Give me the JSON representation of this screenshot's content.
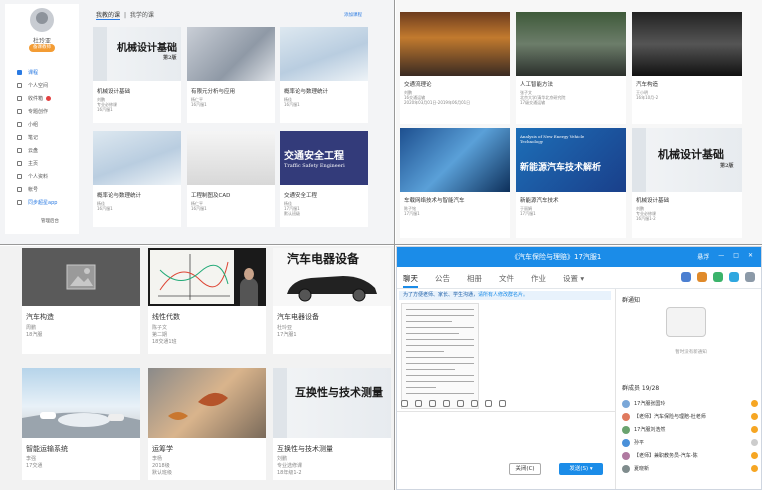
{
  "q1": {
    "user": "杜玲亚",
    "badge": "备课教师",
    "tabs": [
      "我教的课",
      "|",
      "我学的课"
    ],
    "add": "添加课程",
    "menu": [
      "课程",
      "个人空间",
      "收件箱",
      "专题创作",
      "小组",
      "笔记",
      "云盘",
      "主页",
      "个人资料",
      "帐号",
      "同步超星app"
    ],
    "manage": "管理后台",
    "cards": [
      {
        "title": "机械设计基础",
        "meta": [
          "刘鹏",
          "专业必修课",
          "16汽服1"
        ],
        "cover": "机械设计基础",
        "sub": "第2版"
      },
      {
        "title": "有限元分析与应用",
        "meta": [
          "杨仁平",
          "16汽服1"
        ]
      },
      {
        "title": "概率论与数理统计",
        "meta": [
          "杨佳",
          "16汽服1"
        ]
      },
      {
        "title": "概率论与数理统计",
        "meta": [
          "杨佳",
          "16汽服1"
        ]
      },
      {
        "title": "工程制图及CAD",
        "meta": [
          "杨仁平",
          "16汽服1"
        ]
      },
      {
        "title": "交通安全工程",
        "meta": [
          "杨佳",
          "17汽服1",
          "默认班级"
        ],
        "cover": "交通安全工程",
        "sub": "Traffic Safety Engineeri"
      }
    ]
  },
  "q2": {
    "cards": [
      {
        "title": "交通流理论",
        "meta": [
          "刘鹏",
          "16交通运输",
          "2020年03月01日-2019年06月01日"
        ]
      },
      {
        "title": "人工智能方法",
        "meta": [
          "张子文",
          "北京大学/清华北京研究院",
          "17级交通运输"
        ]
      },
      {
        "title": "汽车构造",
        "meta": [
          "王小明",
          "16年10月-2"
        ]
      },
      {
        "title": "车载网络技术与智能汽车",
        "meta": [
          "陈子铭",
          "17汽服1"
        ]
      },
      {
        "title": "新能源汽车技术",
        "meta": [
          "于丽娟",
          "17汽服1"
        ],
        "cover": "新能源汽车技术解析",
        "sub": "Analysis of New Energy Vehicle Technology"
      },
      {
        "title": "机械设计基础",
        "meta": [
          "刘鹏",
          "专业必修课",
          "16汽服1-2"
        ],
        "cover": "机械设计基础",
        "sub": "第2版"
      }
    ]
  },
  "q3": {
    "cards": [
      {
        "title": "汽车构造",
        "meta": [
          "周鹏",
          "18汽服"
        ]
      },
      {
        "title": "线性代数",
        "meta": [
          "陈子文",
          "第二期",
          "18交通1班"
        ]
      },
      {
        "title": "汽车电器设备",
        "meta": [
          "杜玲亚",
          "17汽服1"
        ],
        "cover": "汽车电器设备"
      },
      {
        "title": "智能运输系统",
        "meta": [
          "李强",
          "17交通"
        ]
      },
      {
        "title": "运筹学",
        "meta": [
          "李杨",
          "2018级",
          "默认班级"
        ]
      },
      {
        "title": "互换性与技术测量",
        "meta": [
          "刘鹏",
          "专业选修课",
          "18年级1-2"
        ],
        "cover": "互换性与技术测量"
      }
    ]
  },
  "q4": {
    "title": "《汽车保险与理赔》17汽服1",
    "toprow": [
      "悬浮",
      "—",
      "□",
      "✕"
    ],
    "tabs": [
      "聊天",
      "公告",
      "相册",
      "文件",
      "作业",
      "设置 ▾"
    ],
    "notice": "为了方便老师、家长、学生沟通，",
    "notice_link": "请所有人修改群名片。",
    "right_title": "群通知",
    "no_notice": "暂时没有新通知",
    "members": "群成员 19/28",
    "member_list": [
      "17汽服张国玲",
      "【老师】汽车保险与理赔-杜老师",
      "17汽服刘浩然",
      "孙平",
      "【老师】兼职教务员-汽车-陈",
      "夏晓新"
    ],
    "btn_close": "关闭(C)",
    "btn_send": "发送(S)  ▾"
  },
  "colors": {
    "accent": "#1b8ce8",
    "badge": "#f39c34",
    "dot": "#e24040"
  }
}
